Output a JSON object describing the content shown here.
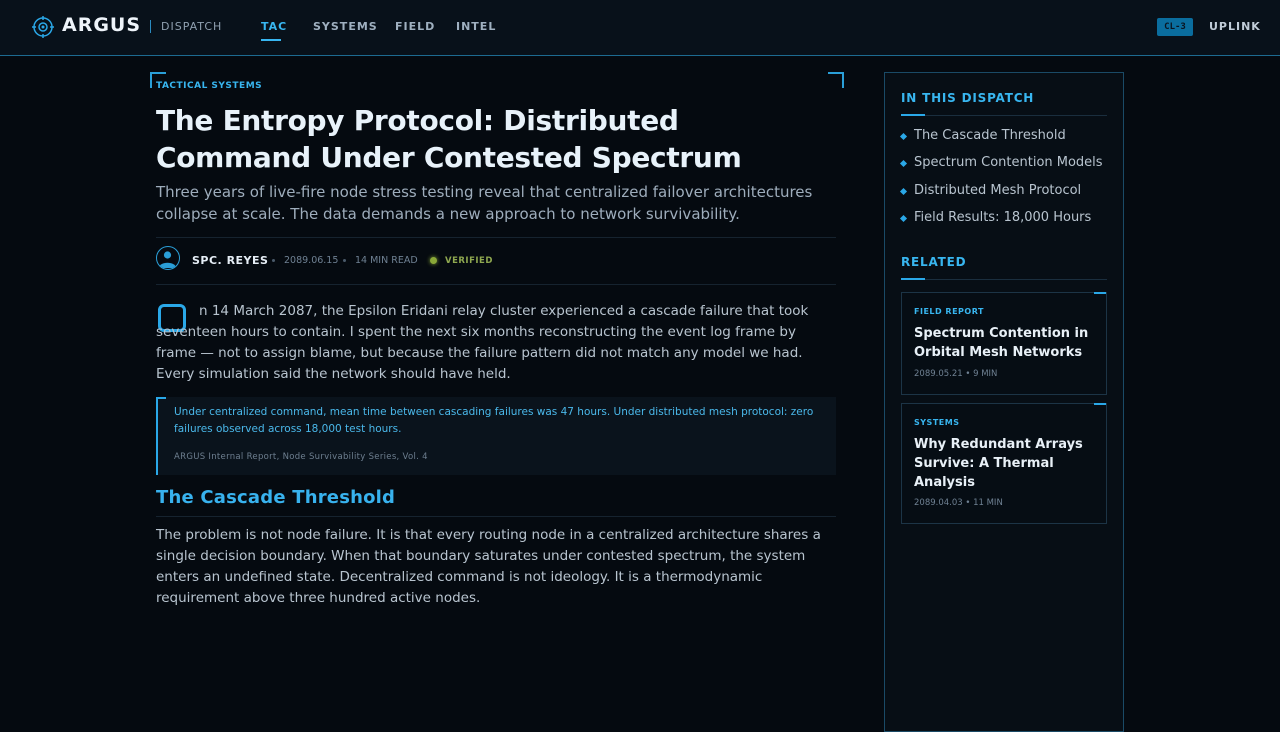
{
  "nav": {
    "logo": "ARGUS",
    "section": "DISPATCH",
    "links": [
      {
        "label": "TAC",
        "active": true
      },
      {
        "label": "SYSTEMS",
        "active": false
      },
      {
        "label": "FIELD",
        "active": false
      },
      {
        "label": "INTEL",
        "active": false
      }
    ],
    "clearance_badge": "CL-3",
    "uplink": "UPLINK"
  },
  "article": {
    "kicker": "TACTICAL SYSTEMS",
    "headline_line1": "The Entropy Protocol: Distributed",
    "headline_line2": "Command Under Contested Spectrum",
    "dek": "Three years of live-fire node stress testing reveal that centralized failover architectures collapse at scale. The data demands a new approach to network survivability.",
    "author": "SPC. REYES",
    "date": "2089.06.15",
    "read_time": "14 MIN READ",
    "status": "VERIFIED",
    "lead": "n 14 March 2087, the Epsilon Eridani relay cluster experienced a cascade failure that took seventeen hours to contain. I spent the next six months reconstructing the event log frame by frame — not to assign blame, but because the failure pattern did not match any model we had. Every simulation said the network should have held.",
    "pullquote": {
      "text": "Under centralized command, mean time between cascading failures was 47 hours. Under distributed mesh protocol: zero failures observed across 18,000 test hours.",
      "source": "ARGUS Internal Report, Node Survivability Series, Vol. 4"
    },
    "section_heading": "The Cascade Threshold",
    "body": "The problem is not node failure. It is that every routing node in a centralized architecture shares a single decision boundary. When that boundary saturates under contested spectrum, the system enters an undefined state. Decentralized command is not ideology. It is a thermodynamic requirement above three hundred active nodes."
  },
  "sidebar": {
    "toc_heading": "IN THIS DISPATCH",
    "toc": [
      "The Cascade Threshold",
      "Spectrum Contention Models",
      "Distributed Mesh Protocol",
      "Field Results: 18,000 Hours"
    ],
    "related_heading": "RELATED",
    "related": [
      {
        "tag": "FIELD REPORT",
        "title": "Spectrum Contention in Orbital Mesh Networks",
        "meta": "2089.05.21 • 9 MIN"
      },
      {
        "tag": "SYSTEMS",
        "title": "Why Redundant Arrays Survive: A Thermal Analysis",
        "meta": "2089.04.03 • 11 MIN"
      }
    ]
  },
  "colors": {
    "accent": "#38b6f0",
    "background": "#050a10",
    "verified": "#8aa838"
  }
}
